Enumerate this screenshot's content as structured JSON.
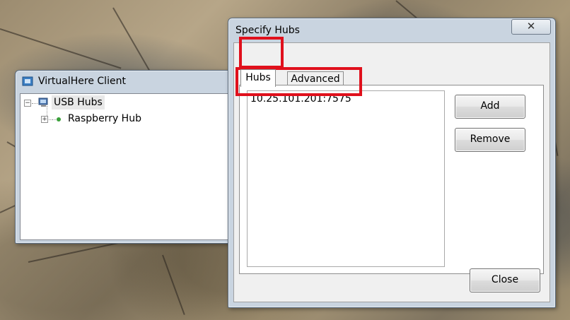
{
  "virtualhere": {
    "title": "VirtualHere Client",
    "tree": {
      "root_label": "USB Hubs",
      "hub_label": "Raspberry Hub"
    }
  },
  "dialog": {
    "title": "Specify Hubs",
    "close_glyph": "✕",
    "tabs": [
      {
        "label": "Hubs"
      },
      {
        "label": "Advanced"
      }
    ],
    "hubs": [
      "10.25.101.201:7575"
    ],
    "add_label": "Add",
    "remove_label": "Remove",
    "close_label": "Close"
  },
  "colors": {
    "highlight": "#e0101c",
    "hub_status": "#3aa03a"
  }
}
